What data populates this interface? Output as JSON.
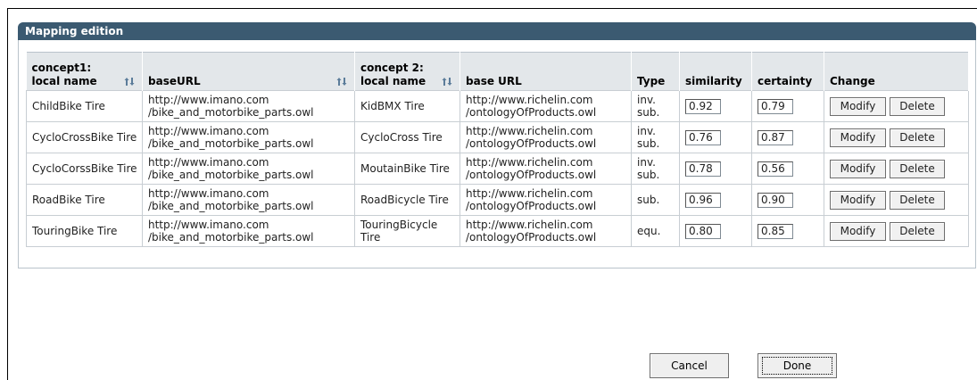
{
  "panel": {
    "title": "Mapping edition"
  },
  "columns": {
    "concept1_top": "concept1:",
    "concept1_bottom": "local name",
    "baseurl1": "baseURL",
    "concept2_top": "concept 2:",
    "concept2_bottom": "local name",
    "baseurl2": "base URL",
    "type": "Type",
    "similarity": "similarity",
    "certainty": "certainty",
    "change": "Change"
  },
  "rows": [
    {
      "c1": "ChildBike Tire",
      "url1": "http://www.imano.com /bike_and_motorbike_parts.owl",
      "c2": "KidBMX Tire",
      "url2": "http://www.richelin.com /ontologyOfProducts.owl",
      "type": "inv. sub.",
      "similarity": "0.92",
      "certainty": "0.79"
    },
    {
      "c1": "CycloCrossBike Tire",
      "url1": "http://www.imano.com /bike_and_motorbike_parts.owl",
      "c2": "CycloCross Tire",
      "url2": "http://www.richelin.com /ontologyOfProducts.owl",
      "type": "inv. sub.",
      "similarity": "0.76",
      "certainty": "0.87"
    },
    {
      "c1": "CycloCorssBike Tire",
      "url1": "http://www.imano.com /bike_and_motorbike_parts.owl",
      "c2": "MoutainBike Tire",
      "url2": "http://www.richelin.com /ontologyOfProducts.owl",
      "type": "inv. sub.",
      "similarity": "0.78",
      "certainty": "0.56"
    },
    {
      "c1": "RoadBike Tire",
      "url1": "http://www.imano.com /bike_and_motorbike_parts.owl",
      "c2": "RoadBicycle Tire",
      "url2": "http://www.richelin.com /ontologyOfProducts.owl",
      "type": "sub.",
      "similarity": "0.96",
      "certainty": "0.90"
    },
    {
      "c1": "TouringBike Tire",
      "url1": "http://www.imano.com /bike_and_motorbike_parts.owl",
      "c2": "TouringBicycle Tire",
      "url2": "http://www.richelin.com /ontologyOfProducts.owl",
      "type": "equ.",
      "similarity": "0.80",
      "certainty": "0.85"
    }
  ],
  "row_buttons": {
    "modify": "Modify",
    "delete": "Delete"
  },
  "dialog": {
    "cancel": "Cancel",
    "done": "Done"
  },
  "icons": {
    "sort": "sort-arrows-icon"
  },
  "colors": {
    "header_bar": "#3b5a71",
    "column_header": "#e3e7ea"
  }
}
